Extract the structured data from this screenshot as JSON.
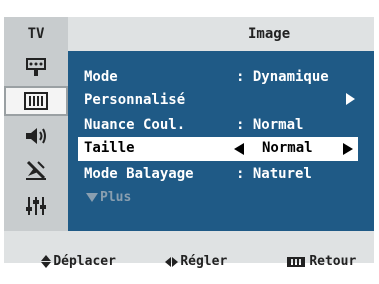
{
  "header": {
    "source": "TV",
    "title": "Image"
  },
  "sidebar": {
    "items": [
      {
        "icon": "input-icon",
        "selected": false
      },
      {
        "icon": "picture-icon",
        "selected": true
      },
      {
        "icon": "sound-icon",
        "selected": false
      },
      {
        "icon": "antenna-icon",
        "selected": false
      },
      {
        "icon": "setup-icon",
        "selected": false
      }
    ]
  },
  "menu": {
    "items": [
      {
        "label": "Mode",
        "value": ": Dynamique"
      },
      {
        "label": "Personnalisé",
        "value": ""
      },
      {
        "label": "Nuance Coul.",
        "value": ": Normal"
      },
      {
        "label": "Mode Balayage",
        "value": ": Naturel"
      }
    ],
    "selected": {
      "label": "Taille",
      "value": "Normal"
    },
    "more": "Plus"
  },
  "footer": {
    "move": "Déplacer",
    "adjust": "Régler",
    "return": "Retour"
  },
  "colors": {
    "background": "#1f5a86",
    "panel": "#dfe2e3",
    "sidebar": "#c8ccce",
    "highlight": "#ffffff",
    "disabled": "#8a9fb0"
  }
}
